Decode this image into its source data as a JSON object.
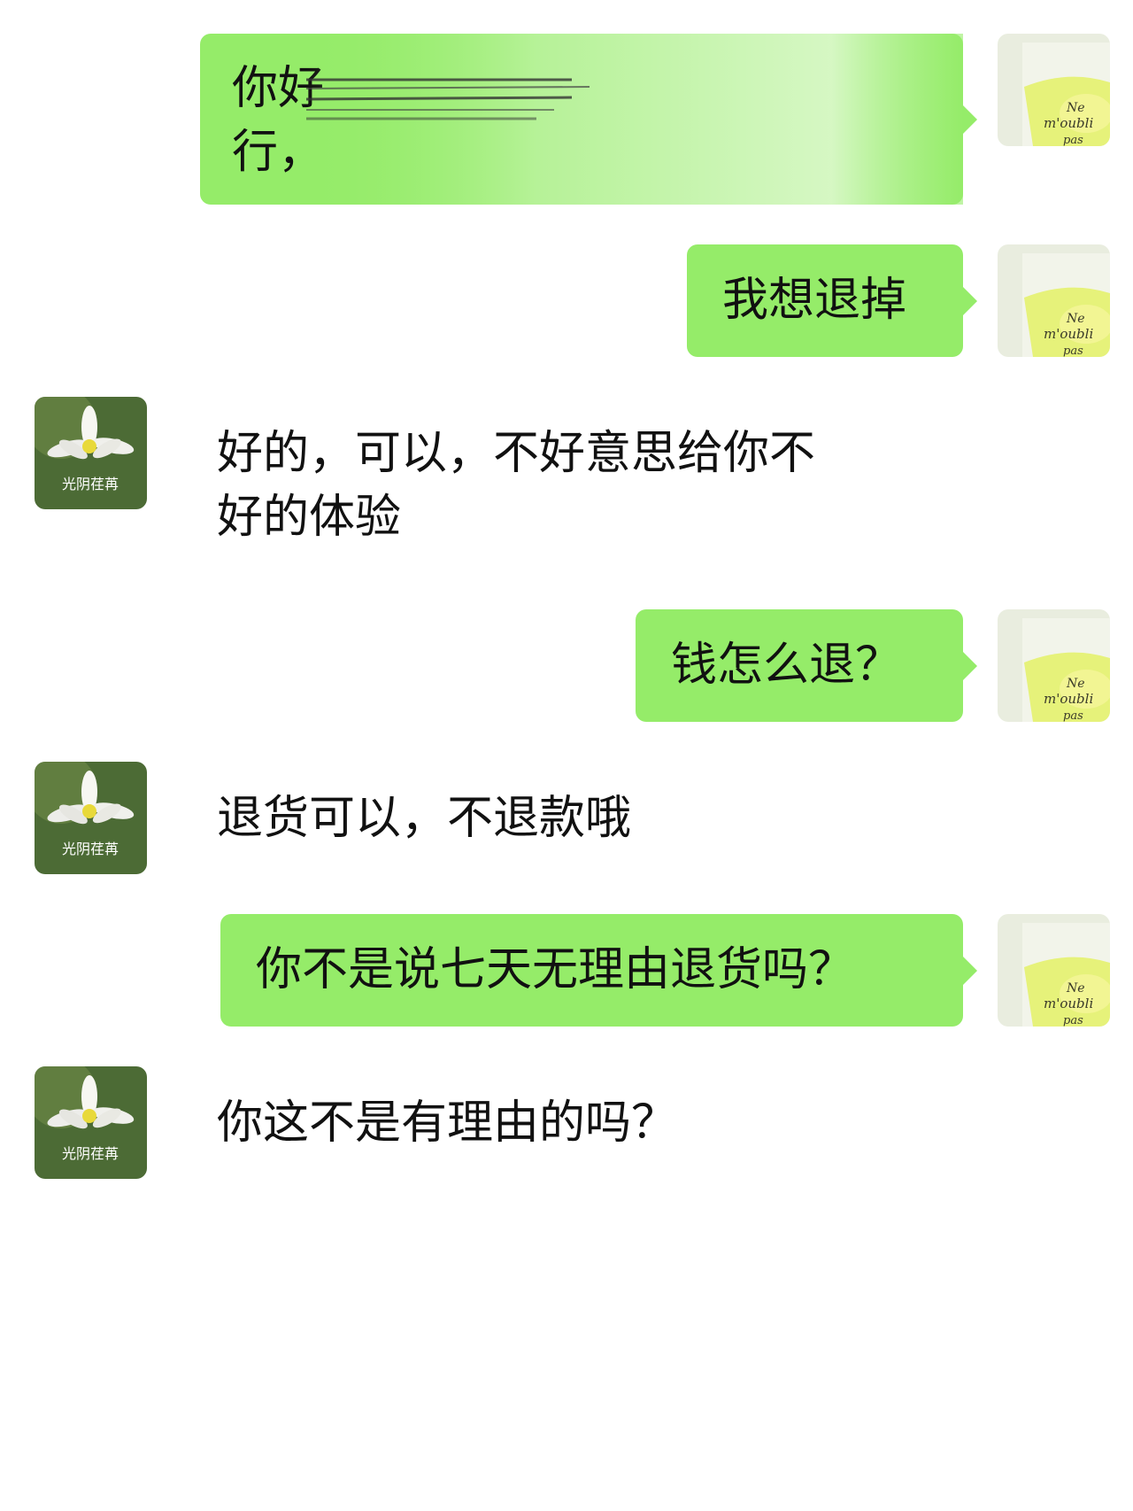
{
  "chat": {
    "messages": [
      {
        "side": "right",
        "lines": [
          "你好",
          "行，"
        ],
        "redacted": true
      },
      {
        "side": "right",
        "lines": [
          "我想退掉"
        ]
      },
      {
        "side": "left",
        "lines": [
          "好的，可以，不好意思给你不",
          "好的体验"
        ]
      },
      {
        "side": "right",
        "lines": [
          "钱怎么退？"
        ]
      },
      {
        "side": "left",
        "lines": [
          "退货可以，不退款哦"
        ]
      },
      {
        "side": "right",
        "lines": [
          "你不是说七天无理由退货吗？"
        ]
      },
      {
        "side": "left",
        "lines": [
          "你这不是有理由的吗？"
        ]
      }
    ],
    "self_avatar_text": "Ne m'oubli pas",
    "other_avatar_text": "光阴荏苒",
    "colors": {
      "bubble": "#95ec69",
      "background": "#ffffff"
    }
  }
}
